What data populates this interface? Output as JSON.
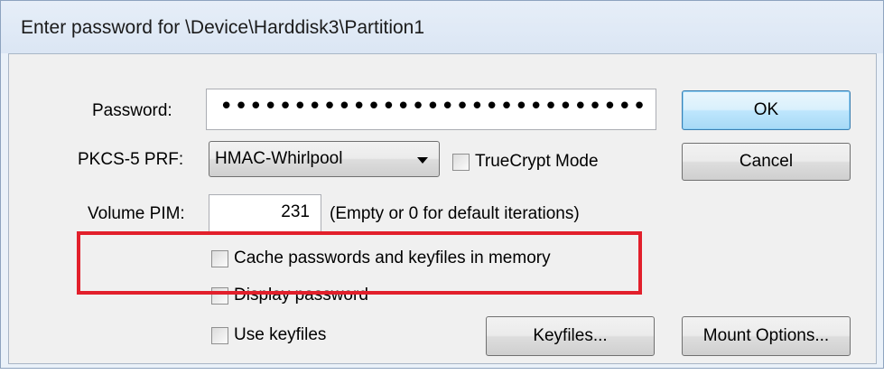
{
  "window": {
    "title": "Enter password for \\Device\\Harddisk3\\Partition1"
  },
  "password": {
    "label": "Password:",
    "value": "•••••••••••••••••••••••••••••"
  },
  "prf": {
    "label": "PKCS-5 PRF:",
    "selected": "HMAC-Whirlpool"
  },
  "truecrypt_mode": {
    "label": "TrueCrypt Mode",
    "checked": false
  },
  "pim": {
    "label": "Volume PIM:",
    "value": "231",
    "hint": "(Empty or 0 for default iterations)"
  },
  "options": {
    "cache": {
      "label": "Cache passwords and keyfiles in memory",
      "checked": false
    },
    "display_password": {
      "label": "Display password",
      "checked": false
    },
    "use_keyfiles": {
      "label": "Use keyfiles",
      "checked": false
    }
  },
  "buttons": {
    "ok": "OK",
    "cancel": "Cancel",
    "keyfiles": "Keyfiles...",
    "mount_options": "Mount Options..."
  },
  "colors": {
    "highlight": "#e21f2b",
    "default_button": "#bee6fd"
  }
}
